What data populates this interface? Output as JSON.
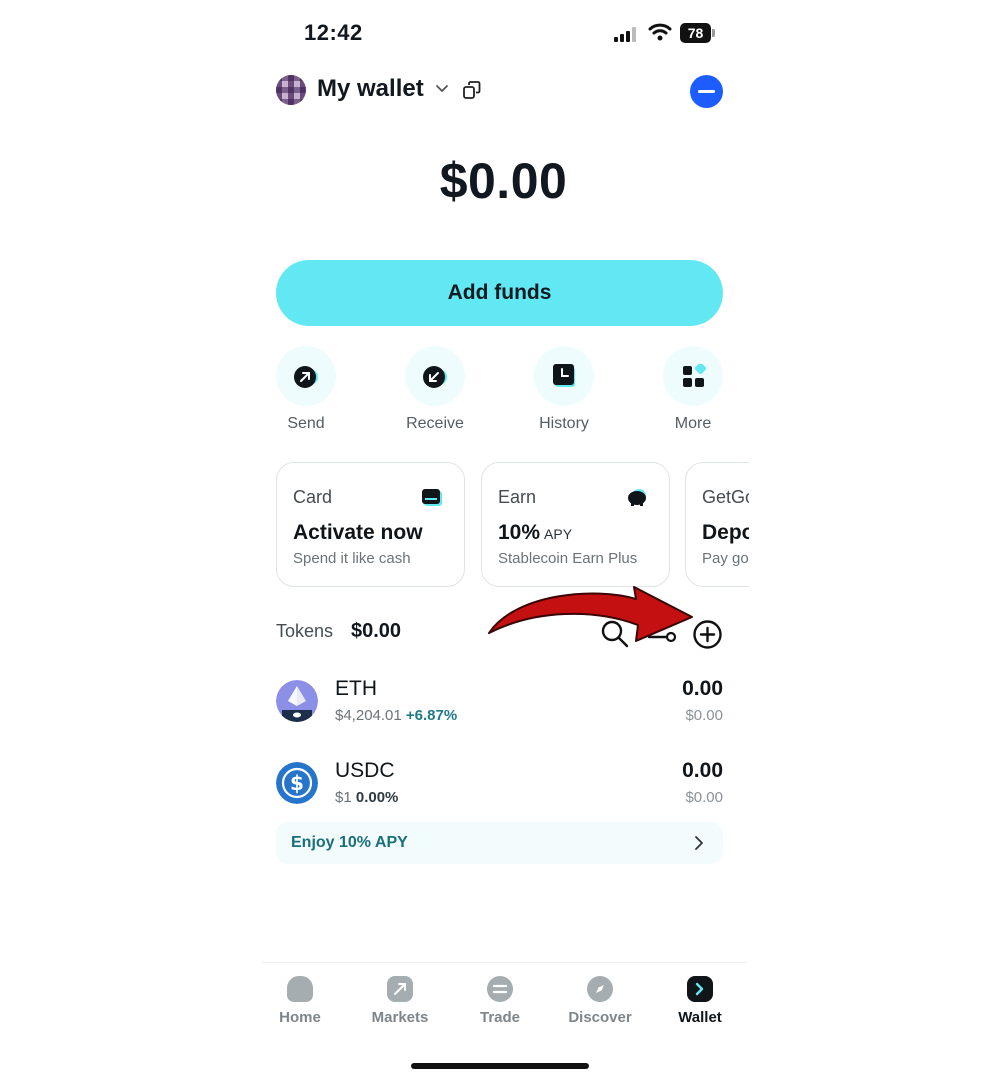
{
  "status_bar": {
    "time": "12:42",
    "battery": "78"
  },
  "header": {
    "title": "My wallet"
  },
  "balance": "$0.00",
  "add_funds_label": "Add funds",
  "actions": [
    {
      "label": "Send",
      "icon": "arrow-up-right-icon"
    },
    {
      "label": "Receive",
      "icon": "arrow-down-left-icon"
    },
    {
      "label": "History",
      "icon": "clock-icon"
    },
    {
      "label": "More",
      "icon": "grid-icon"
    }
  ],
  "cards": [
    {
      "title": "Card",
      "main": "Activate now",
      "sub": "Spend it like cash",
      "icon": "card-icon"
    },
    {
      "title": "Earn",
      "main": "10%",
      "main_suffix": "APY",
      "sub": "Stablecoin Earn Plus",
      "icon": "piggy-bank-icon"
    },
    {
      "title": "GetGo",
      "main": "Deposit",
      "sub": "Pay go",
      "icon": "getgo-icon"
    }
  ],
  "tokens": {
    "label": "Tokens",
    "total": "$0.00",
    "rows": [
      {
        "name": "ETH",
        "price": "$4,204.01",
        "change": "+6.87%",
        "amount": "0.00",
        "value": "$0.00",
        "icon": "ethereum-icon"
      },
      {
        "name": "USDC",
        "price": "$1",
        "change": "0.00%",
        "amount": "0.00",
        "value": "$0.00",
        "icon": "usdc-icon"
      }
    ]
  },
  "apy_banner": "Enjoy 10% APY",
  "nav": [
    {
      "label": "Home",
      "icon": "home-icon"
    },
    {
      "label": "Markets",
      "icon": "markets-icon"
    },
    {
      "label": "Trade",
      "icon": "trade-icon"
    },
    {
      "label": "Discover",
      "icon": "compass-icon"
    },
    {
      "label": "Wallet",
      "icon": "wallet-icon",
      "active": true
    }
  ],
  "colors": {
    "accent": "#62e8f3",
    "positive": "#1e7b86",
    "profile": "#1d5cff",
    "annotation_arrow": "#c41010"
  }
}
